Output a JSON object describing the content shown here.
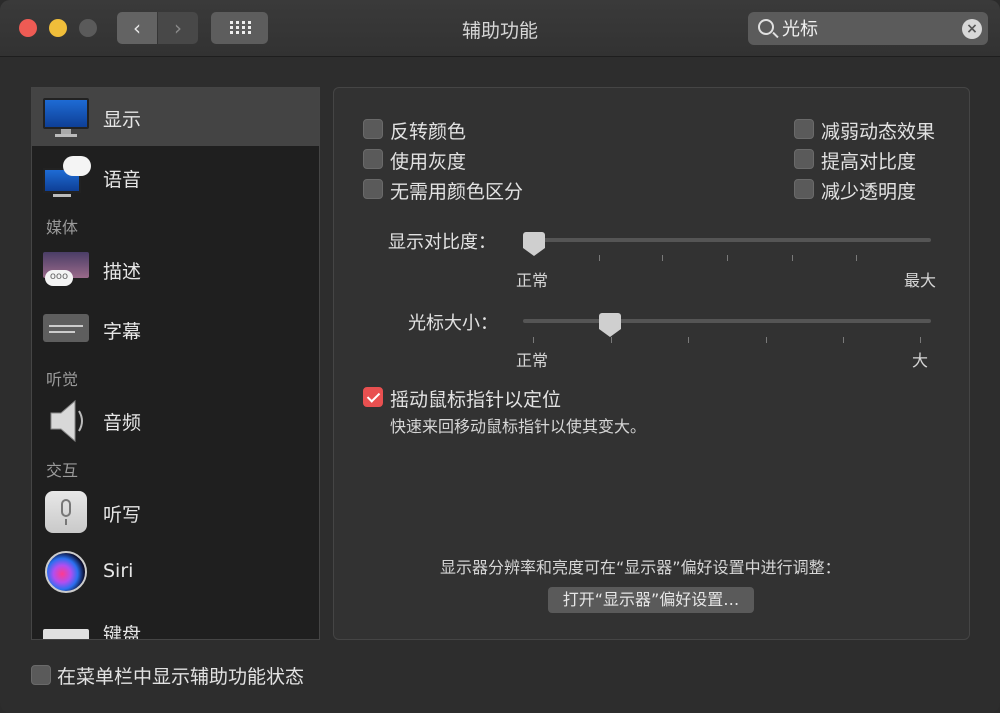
{
  "window": {
    "title": "辅助功能"
  },
  "search": {
    "value": "光标",
    "placeholder": ""
  },
  "sidebar": {
    "items": [
      {
        "label": "显示",
        "icon": "display-icon",
        "selected": true
      },
      {
        "label": "语音",
        "icon": "speech-icon"
      },
      {
        "label": "描述",
        "icon": "description-icon"
      },
      {
        "label": "字幕",
        "icon": "captions-icon"
      },
      {
        "label": "音频",
        "icon": "speaker-icon"
      },
      {
        "label": "听写",
        "icon": "microphone-icon"
      },
      {
        "label": "Siri",
        "icon": "siri-icon"
      },
      {
        "label": "键盘",
        "icon": "keyboard-icon"
      }
    ],
    "headers": {
      "media": "媒体",
      "hearing": "听觉",
      "interaction": "交互"
    }
  },
  "display": {
    "checkboxes": {
      "invert": {
        "label": "反转颜色",
        "checked": false
      },
      "grayscale": {
        "label": "使用灰度",
        "checked": false
      },
      "differentiate": {
        "label": "无需用颜色区分",
        "checked": false
      },
      "reduce_motion": {
        "label": "减弱动态效果",
        "checked": false
      },
      "increase_contrast": {
        "label": "提高对比度",
        "checked": false
      },
      "reduce_transparency": {
        "label": "减少透明度",
        "checked": false
      }
    },
    "contrast_slider": {
      "label": "显示对比度：",
      "min_label": "正常",
      "max_label": "最大",
      "value": 0
    },
    "cursor_slider": {
      "label": "光标大小：",
      "min_label": "正常",
      "max_label": "大",
      "value": 0.2
    },
    "shake_to_locate": {
      "label": "摇动鼠标指针以定位",
      "checked": true,
      "description": "快速来回移动鼠标指针以使其变大。"
    },
    "footer_note": "显示器分辨率和亮度可在“显示器”偏好设置中进行调整：",
    "open_button": "打开“显示器”偏好设置…"
  },
  "bottom": {
    "menubar_status": {
      "label": "在菜单栏中显示辅助功能状态",
      "checked": false
    }
  },
  "colors": {
    "accent": "#e85050",
    "selected_row": "#444444"
  }
}
